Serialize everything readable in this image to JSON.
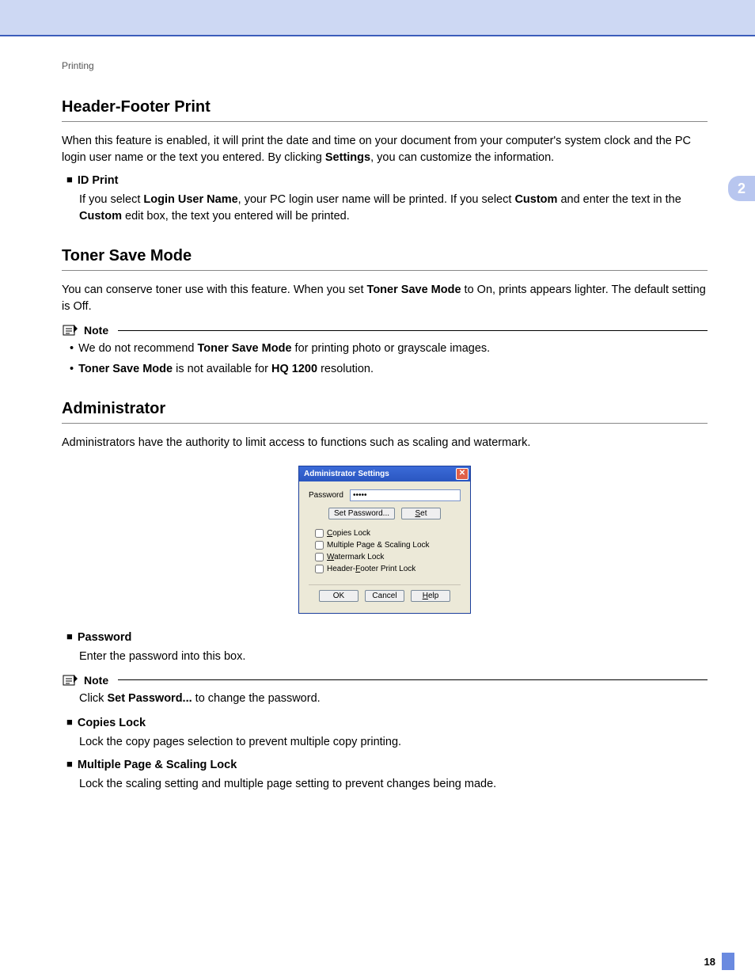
{
  "breadcrumb": "Printing",
  "chapter_tab": "2",
  "page_number": "18",
  "sections": {
    "header_footer": {
      "title": "Header-Footer Print",
      "para_pre": "When this feature is enabled, it will print the date and time on your document from your computer's system clock and the PC login user name or the text you entered. By clicking ",
      "para_bold": "Settings",
      "para_post": ", you can customize the information.",
      "id_print": {
        "label": "ID Print",
        "p1": "If you select ",
        "b1": "Login User Name",
        "p2": ", your PC login user name will be printed. If you select ",
        "b2": "Custom",
        "p3": " and enter the text in the ",
        "b3": "Custom",
        "p4": " edit box, the text you entered will be printed."
      }
    },
    "toner_save": {
      "title": "Toner Save Mode",
      "p1": "You can conserve toner use with this feature. When you set ",
      "b1": "Toner Save Mode",
      "p2": " to On, prints appears lighter. The default setting is Off.",
      "note_label": "Note",
      "note1_a": "We do not recommend ",
      "note1_b": "Toner Save Mode",
      "note1_c": " for printing photo or grayscale images.",
      "note2_a": "Toner Save Mode",
      "note2_b": " is not available for ",
      "note2_c": "HQ 1200",
      "note2_d": " resolution."
    },
    "admin": {
      "title": "Administrator",
      "para": "Administrators have the authority to limit access to functions such as scaling and watermark.",
      "password_label": "Password",
      "password_desc": "Enter the password into this box.",
      "note_label": "Note",
      "note_a": "Click ",
      "note_b": "Set Password...",
      "note_c": " to change the password.",
      "copies_lock_label": "Copies Lock",
      "copies_lock_desc": "Lock the copy pages selection to prevent multiple copy printing.",
      "mps_lock_label": "Multiple Page & Scaling Lock",
      "mps_lock_desc": "Lock the scaling setting and multiple page setting to prevent changes being made."
    }
  },
  "dialog": {
    "title": "Administrator Settings",
    "password_label": "Password",
    "password_value": "•••••",
    "set_password_btn": "Set Password...",
    "set_btn": "Set",
    "checks": {
      "copies": "Copies Lock",
      "mps": "Multiple Page & Scaling Lock",
      "watermark": "Watermark Lock",
      "headerfooter": "Header-Footer Print Lock"
    },
    "ok": "OK",
    "cancel": "Cancel",
    "help": "Help"
  }
}
